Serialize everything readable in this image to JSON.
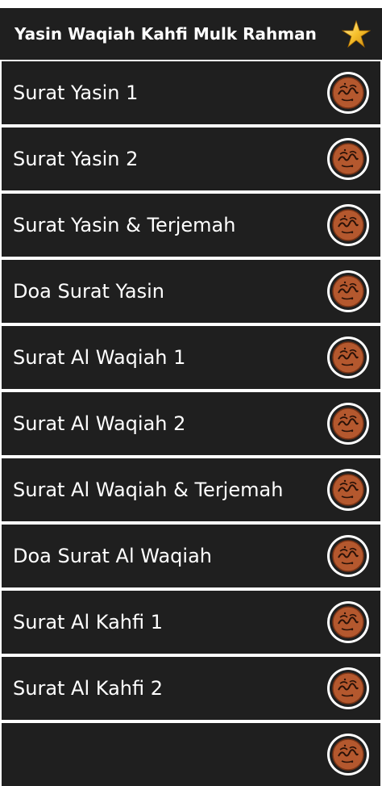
{
  "header": {
    "title": "Yasin Waqiah Kahfi Mulk Rahman",
    "favorite_icon": "star-icon"
  },
  "colors": {
    "bar_background": "#1f1f1f",
    "separator": "#ffffff",
    "text": "#ffffff",
    "star": "#f6c02c",
    "badge_inner": "#b4582e"
  },
  "items": [
    {
      "label": "Surat Yasin 1",
      "icon": "calligraphy-icon"
    },
    {
      "label": "Surat Yasin 2",
      "icon": "calligraphy-icon"
    },
    {
      "label": "Surat Yasin & Terjemah",
      "icon": "calligraphy-icon"
    },
    {
      "label": "Doa Surat Yasin",
      "icon": "calligraphy-icon"
    },
    {
      "label": "Surat Al Waqiah 1",
      "icon": "calligraphy-icon"
    },
    {
      "label": "Surat Al Waqiah 2",
      "icon": "calligraphy-icon"
    },
    {
      "label": "Surat Al Waqiah & Terjemah",
      "icon": "calligraphy-icon"
    },
    {
      "label": "Doa Surat Al Waqiah",
      "icon": "calligraphy-icon"
    },
    {
      "label": "Surat Al Kahfi 1",
      "icon": "calligraphy-icon"
    },
    {
      "label": "Surat Al Kahfi 2",
      "icon": "calligraphy-icon"
    },
    {
      "label": "",
      "icon": "calligraphy-icon"
    }
  ]
}
